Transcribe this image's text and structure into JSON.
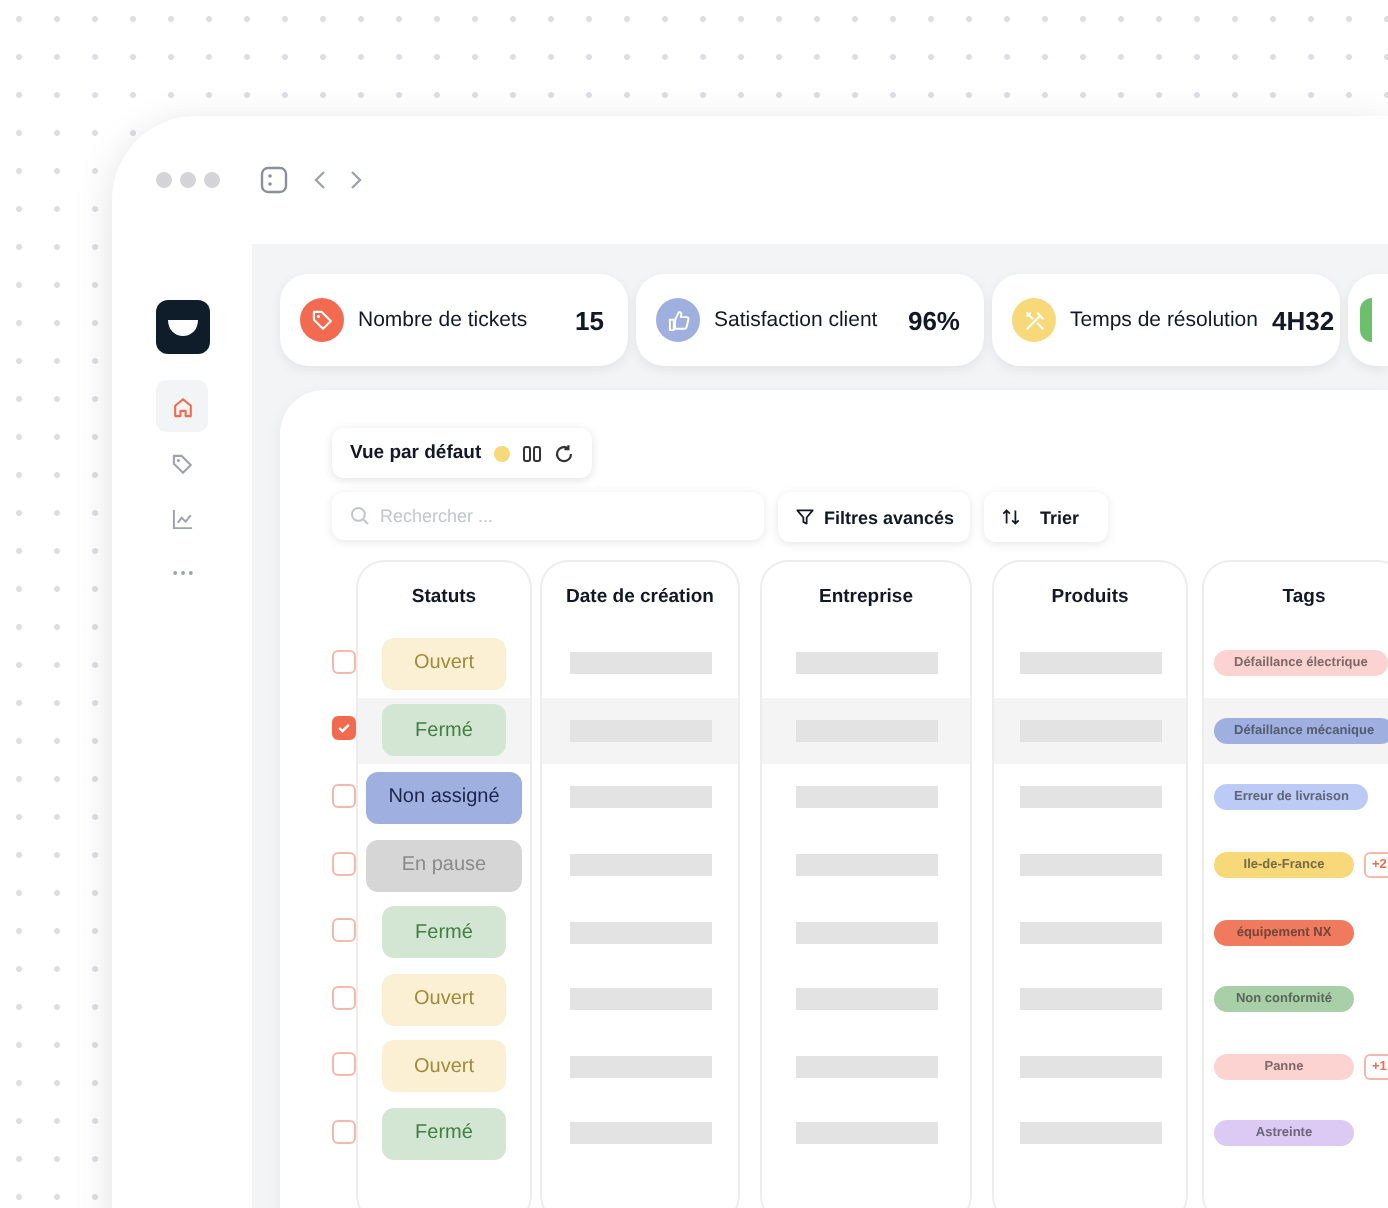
{
  "sidebar": {
    "items": [
      {
        "kind": "home",
        "selected": true
      },
      {
        "kind": "tag",
        "selected": false
      },
      {
        "kind": "chart",
        "selected": false
      },
      {
        "kind": "more",
        "selected": false
      }
    ]
  },
  "stats": [
    {
      "label": "Nombre de tickets",
      "value": "15",
      "kind": "tag",
      "color": "#f26b50"
    },
    {
      "label": "Satisfaction client",
      "value": "96%",
      "kind": "thumb",
      "color": "#9fb0e0"
    },
    {
      "label": "Temps de résolution",
      "value": "4H32",
      "kind": "tools",
      "color": "#f7d97a"
    }
  ],
  "view": {
    "label": "Vue par défaut"
  },
  "search": {
    "placeholder": "Rechercher ..."
  },
  "buttons": [
    {
      "label": "Filtres avancés",
      "kind": "filter"
    },
    {
      "label": "Trier",
      "kind": "sort"
    }
  ],
  "table": {
    "columns": [
      "Statuts",
      "Date de création",
      "Entreprise",
      "Produits",
      "Tags"
    ],
    "rows": [
      {
        "checked": false,
        "status": {
          "label": "Ouvert",
          "kind": "open"
        },
        "tags": [
          {
            "label": "Défaillance électrique",
            "color": "#fdd3d1"
          }
        ]
      },
      {
        "checked": true,
        "status": {
          "label": "Fermé",
          "kind": "closed"
        },
        "tags": [
          {
            "label": "Défaillance mécanique",
            "color": "#9fb0e0"
          }
        ]
      },
      {
        "checked": false,
        "status": {
          "label": "Non assigné",
          "kind": "unassigned"
        },
        "tags": [
          {
            "label": "Erreur de livraison",
            "color": "#bccaf6"
          }
        ]
      },
      {
        "checked": false,
        "status": {
          "label": "En pause",
          "kind": "paused"
        },
        "tags": [
          {
            "label": "Ile-de-France",
            "color": "#f7d97a"
          }
        ],
        "more": "+2"
      },
      {
        "checked": false,
        "status": {
          "label": "Fermé",
          "kind": "closed"
        },
        "tags": [
          {
            "label": "équipement NX",
            "color": "#f07a5e"
          }
        ]
      },
      {
        "checked": false,
        "status": {
          "label": "Ouvert",
          "kind": "open"
        },
        "tags": [
          {
            "label": "Non conformité",
            "color": "#a9cfa9"
          }
        ]
      },
      {
        "checked": false,
        "status": {
          "label": "Ouvert",
          "kind": "open"
        },
        "tags": [
          {
            "label": "Panne",
            "color": "#fdd3d1"
          }
        ],
        "more": "+1"
      },
      {
        "checked": false,
        "status": {
          "label": "Fermé",
          "kind": "closed"
        },
        "tags": [
          {
            "label": "Astreinte",
            "color": "#dccaf5"
          }
        ]
      }
    ]
  }
}
